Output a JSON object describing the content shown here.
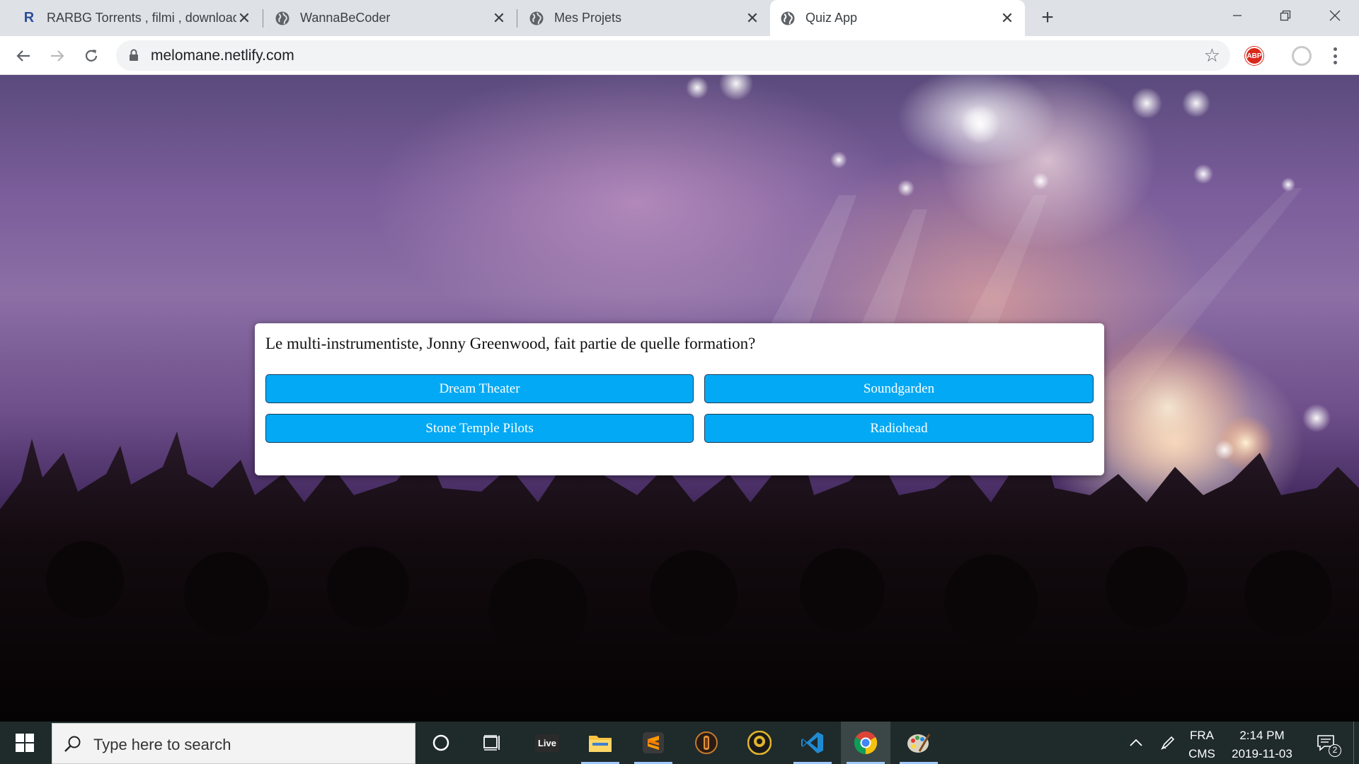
{
  "browser": {
    "tabs": [
      {
        "title": "RARBG Torrents , filmi , download",
        "favicon": "rarbg-r-icon",
        "active": false
      },
      {
        "title": "WannaBeCoder",
        "favicon": "globe-icon",
        "active": false
      },
      {
        "title": "Mes Projets",
        "favicon": "globe-icon",
        "active": false
      },
      {
        "title": "Quiz App",
        "favicon": "globe-icon",
        "active": true
      }
    ],
    "close_glyph": "✕",
    "new_tab_glyph": "+",
    "url": "melomane.netlify.com",
    "abp_label": "ABP"
  },
  "quiz": {
    "question": "Le multi-instrumentiste, Jonny Greenwood, fait partie de quelle formation?",
    "answers": [
      "Dream Theater",
      "Soundgarden",
      "Stone Temple Pilots",
      "Radiohead"
    ],
    "button_color": "#03a9f4"
  },
  "taskbar": {
    "search_placeholder": "Type here to search",
    "live_label": "Live",
    "lang_top": "FRA",
    "lang_bottom": "CMS",
    "time": "2:14 PM",
    "date": "2019-11-03",
    "notification_count": "2"
  }
}
